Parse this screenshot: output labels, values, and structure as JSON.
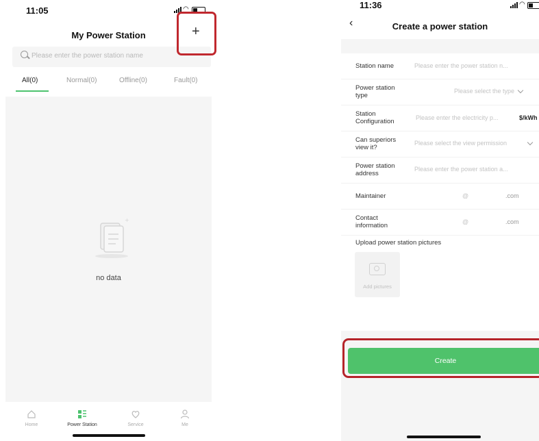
{
  "left_screen": {
    "time": "11:05",
    "title": "My Power Station",
    "add_icon": "+",
    "search_placeholder": "Please enter the power station name",
    "tabs": [
      "All(0)",
      "Normal(0)",
      "Offline(0)",
      "Fault(0)"
    ],
    "active_tab": "All(0)",
    "empty_text": "no data",
    "bottom_nav": [
      "Home",
      "Power Station",
      "Service",
      "Me"
    ],
    "active_nav": "Power Station",
    "accent_color": "#4cc26e"
  },
  "right_screen": {
    "time": "11:36",
    "back_icon": "‹",
    "title": "Create a power station",
    "fields": [
      {
        "label": "Station name",
        "value": "Please enter the power station n..."
      },
      {
        "label": "Power station type",
        "value": "Please select the type"
      },
      {
        "label": "Station Configuration",
        "value": "Please enter the electricity p...",
        "unit": "$/kWh"
      },
      {
        "label": "Can superiors view it?",
        "value": "Please select the view permission"
      },
      {
        "label": "Power station address",
        "value": "Please enter the power station a..."
      },
      {
        "label": "Maintainer",
        "value": "@",
        "suffix": ".com"
      },
      {
        "label": "Contact information",
        "value": "@",
        "suffix": ".com"
      }
    ],
    "upload_label": "Upload power station pictures",
    "add_pictures": "Add pictures",
    "create_button": "Create",
    "button_color": "#4fc26b"
  },
  "highlight_color": "#c0282e"
}
